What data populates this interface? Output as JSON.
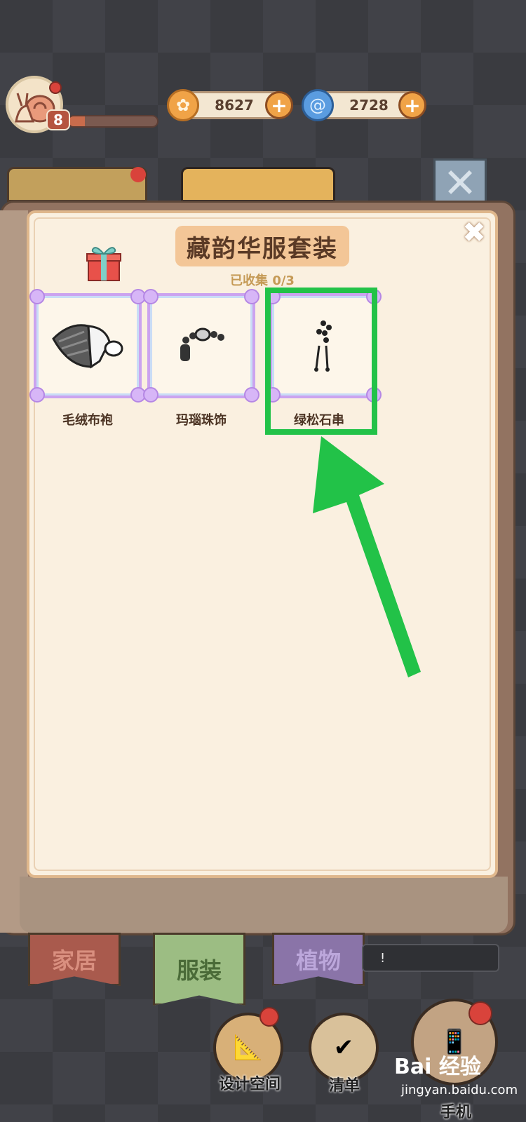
{
  "hud": {
    "level": "8",
    "xp_progress": 0.18,
    "coins": "8627",
    "gems": "2728",
    "plus": "+"
  },
  "panel": {
    "title": "藏韵华服套装",
    "collected": "已收集 0/3",
    "close": "✖",
    "items": [
      {
        "label": "毛绒布袍",
        "icon": "fur-robe-icon"
      },
      {
        "label": "玛瑙珠饰",
        "icon": "agate-beads-icon"
      },
      {
        "label": "绿松石串",
        "icon": "turquoise-string-icon"
      }
    ]
  },
  "tabs": {
    "home": "家居",
    "clothes": "服装",
    "plants": "植物",
    "tip": "!"
  },
  "buttons": {
    "design": "设计空间",
    "list": "清单",
    "phone": "手机"
  },
  "watermark": {
    "brand": "Bai 经验",
    "url": "jingyan.baidu.com"
  },
  "colors": {
    "highlight": "#22c248",
    "accent": "#f0a347"
  }
}
